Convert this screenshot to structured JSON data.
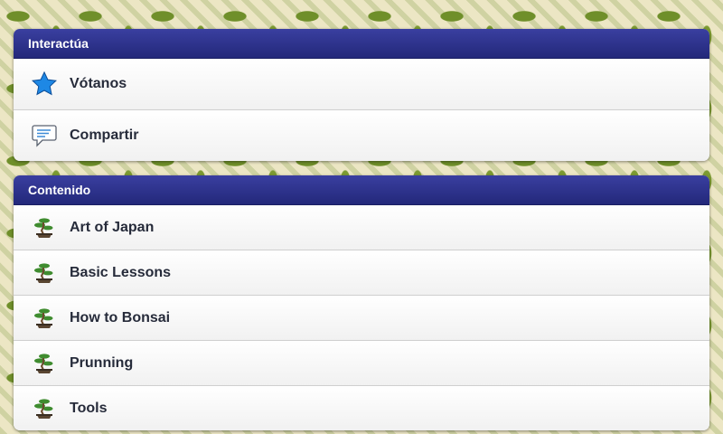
{
  "sections": [
    {
      "header": "Interactúa",
      "items": [
        {
          "label": "Vótanos",
          "icon": "star-icon"
        },
        {
          "label": "Compartir",
          "icon": "chat-bubble-icon"
        }
      ]
    },
    {
      "header": "Contenido",
      "items": [
        {
          "label": "Art of Japan",
          "icon": "bonsai-tree-icon"
        },
        {
          "label": "Basic Lessons",
          "icon": "bonsai-tree-icon"
        },
        {
          "label": "How to Bonsai",
          "icon": "bonsai-tree-icon"
        },
        {
          "label": "Prunning",
          "icon": "bonsai-tree-icon"
        },
        {
          "label": "Tools",
          "icon": "bonsai-tree-icon"
        }
      ]
    }
  ],
  "colors": {
    "header_bg": "#2b3090",
    "header_text": "#ffffff",
    "row_text": "#262b3a",
    "star": "#1e88e5",
    "bonsai_foliage": "#3f8c2f",
    "bonsai_trunk": "#6b4a2b"
  }
}
